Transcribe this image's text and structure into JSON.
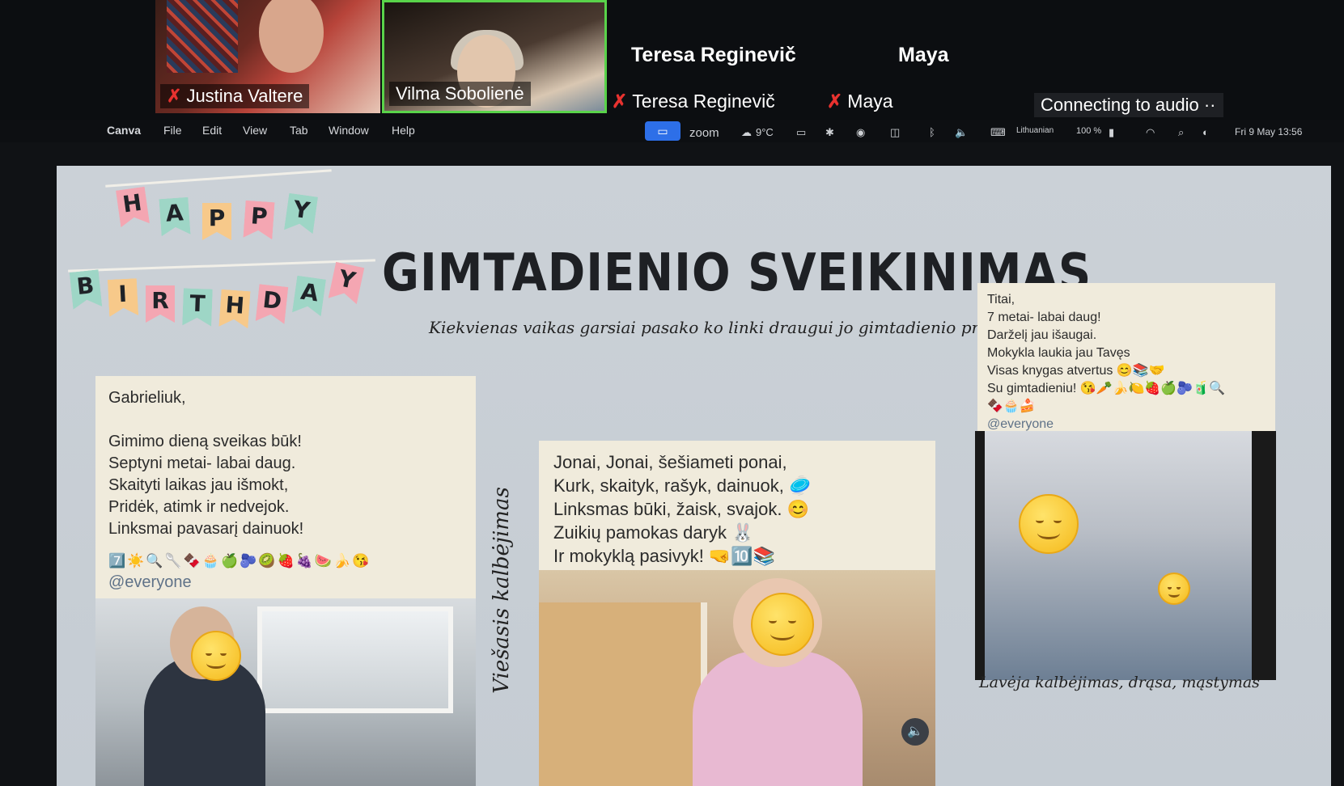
{
  "zoom": {
    "participants": [
      {
        "name": "Justina Valtere",
        "muted": true
      },
      {
        "name": "Vilma Sobolienė",
        "muted": false,
        "active_speaker": true
      }
    ],
    "named_tiles": [
      {
        "big_name": "Teresa Reginevič",
        "small_name": "Teresa Reginevič",
        "muted": true
      },
      {
        "big_name": "Maya",
        "small_name": "Maya",
        "muted": true
      }
    ],
    "connecting_text": "Connecting to audio ··"
  },
  "menubar": {
    "app": "Canva",
    "items": [
      "File",
      "Edit",
      "View",
      "Tab",
      "Window",
      "Help"
    ],
    "zoom_label": "zoom",
    "weather": "9°C",
    "input_lang": "Lithuanian",
    "battery": "100 %",
    "datetime": "Fri 9 May 13:56"
  },
  "slide": {
    "bunting_top": [
      "H",
      "A",
      "P",
      "P",
      "Y"
    ],
    "bunting_bottom": [
      "B",
      "I",
      "R",
      "T",
      "H",
      "D",
      "A",
      "Y"
    ],
    "bunting_colors": [
      "#f4a6b2",
      "#9ed6c6",
      "#f7c98a",
      "#f4a6b2",
      "#9ed6c6",
      "#f7c98a",
      "#f4a6b2",
      "#9ed6c6"
    ],
    "title": "GIMTADIENIO SVEIKINIMAS",
    "subtitle": "Kiekvienas vaikas garsiai pasako ko linki draugui jo gimtadienio proga",
    "note1": {
      "lines": [
        "Gabrieliuk,",
        "",
        "Gimimo dieną sveikas būk!",
        "Septyni metai- labai daug.",
        "Skaityti laikas jau išmokt,",
        "Pridėk, atimk ir nedvejok.",
        "Linksmai pavasarį dainuok!"
      ],
      "emoji": "7️⃣☀️🔍🥄🍫🧁🍏🫐🥝🍓🍇🍉🍌😘",
      "mention": "@everyone"
    },
    "note2": {
      "lines": [
        "Jonai, Jonai, šešiameti ponai,",
        "Kurk, skaityk, rašyk, dainuok, 🥏",
        "Linksmas būki, žaisk, svajok. 😊",
        "Zuikių pamokas daryk 🐰",
        "Ir mokyklą pasivyk! 🤜🔟📚"
      ]
    },
    "note3": {
      "lines": [
        "Titai,",
        "7 metai- labai daug!",
        "Darželį jau išaugai.",
        "Mokykla laukia jau Tavęs",
        "Visas knygas atvertus 😊📚🤝",
        "Su gimtadieniu! 😘🥕🍌🍋🍓🍏🫐🧃🔍",
        "🍫🧁🍰"
      ],
      "mention": "@everyone"
    },
    "side_label": "Viešasis kalbėjimas",
    "caption_right": "Lavėja kalbėjimas, drąsa, mąstymas"
  }
}
